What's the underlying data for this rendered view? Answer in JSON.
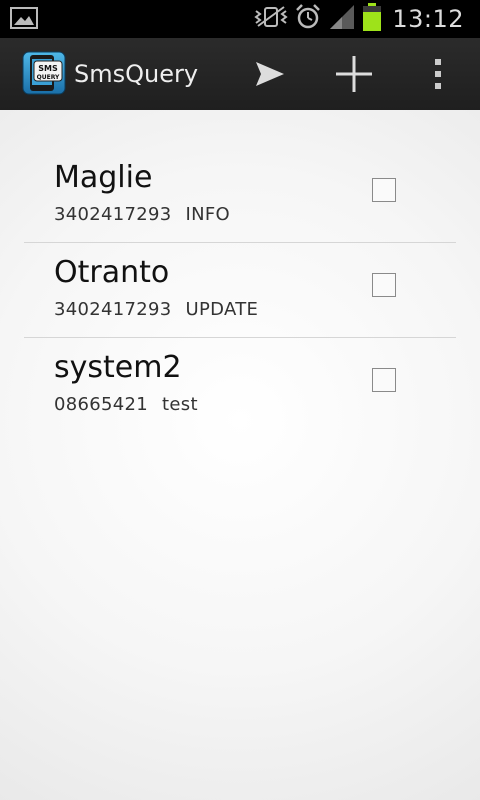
{
  "status_bar": {
    "time": "13:12",
    "icons": [
      "gallery-icon",
      "vibrate-icon",
      "alarm-icon",
      "signal-icon",
      "battery-icon"
    ],
    "battery_color": "#9ee21a"
  },
  "action_bar": {
    "title": "SmsQuery",
    "app_icon_text": "SMS QUERY",
    "actions": [
      "send-icon",
      "add-icon",
      "overflow-menu-icon"
    ]
  },
  "list": {
    "items": [
      {
        "name": "Maglie",
        "number": "3402417293",
        "command": "INFO",
        "checked": false
      },
      {
        "name": "Otranto",
        "number": "3402417293",
        "command": "UPDATE",
        "checked": false
      },
      {
        "name": "system2",
        "number": "08665421",
        "command": "test",
        "checked": false
      }
    ]
  }
}
